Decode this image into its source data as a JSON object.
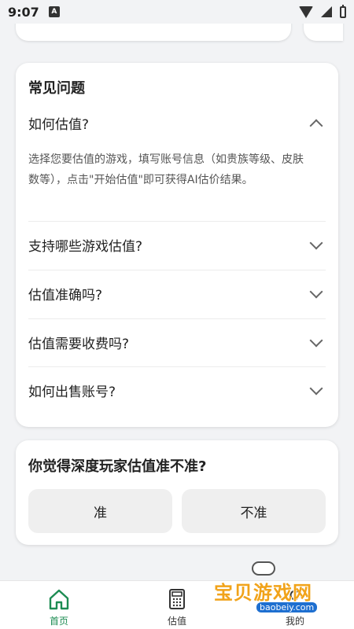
{
  "status_bar": {
    "time": "9:07",
    "notification_badge": "A"
  },
  "faq": {
    "title": "常见问题",
    "items": [
      {
        "question": "如何估值?",
        "expanded": true,
        "answer": "选择您要估值的游戏，填写账号信息（如贵族等级、皮肤数等），点击\"开始估值\"即可获得AI估价结果。"
      },
      {
        "question": "支持哪些游戏估值?",
        "expanded": false
      },
      {
        "question": "估值准确吗?",
        "expanded": false
      },
      {
        "question": "估值需要收费吗?",
        "expanded": false
      },
      {
        "question": "如何出售账号?",
        "expanded": false
      }
    ]
  },
  "vote": {
    "question": "你觉得深度玩家估值准不准?",
    "options": [
      "准",
      "不准"
    ]
  },
  "tabbar": {
    "tabs": [
      {
        "label": "首页",
        "icon": "home-icon",
        "active": true
      },
      {
        "label": "估值",
        "icon": "calculator-icon",
        "active": false
      },
      {
        "label": "我的",
        "icon": "user-icon",
        "active": false
      }
    ],
    "active_color": "#1d8c53"
  },
  "watermark": {
    "text": "宝贝游戏网",
    "url": "baobeiy.com"
  }
}
